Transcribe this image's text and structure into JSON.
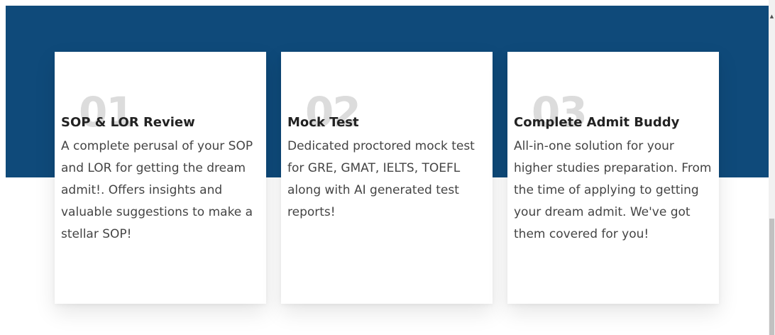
{
  "cards": [
    {
      "number": "01",
      "title": "SOP & LOR Review",
      "description": "A complete perusal of your SOP and LOR for getting the dream admit!. Offers insights and valuable suggestions to make a stellar SOP!"
    },
    {
      "number": "02",
      "title": "Mock Test",
      "description": "Dedicated proctored mock test for GRE, GMAT, IELTS, TOEFL along with AI generated test reports!"
    },
    {
      "number": "03",
      "title": "Complete Admit Buddy",
      "description": "All-in-one solution for your higher studies preparation. From the time of applying to getting your dream admit. We've got them covered for you!"
    }
  ],
  "colors": {
    "banner": "#0f4a7a",
    "card_background": "#ffffff",
    "number_watermark": "#dcdcdc"
  },
  "scrollbar": {
    "up_arrow_icon": "caret-up-icon"
  }
}
